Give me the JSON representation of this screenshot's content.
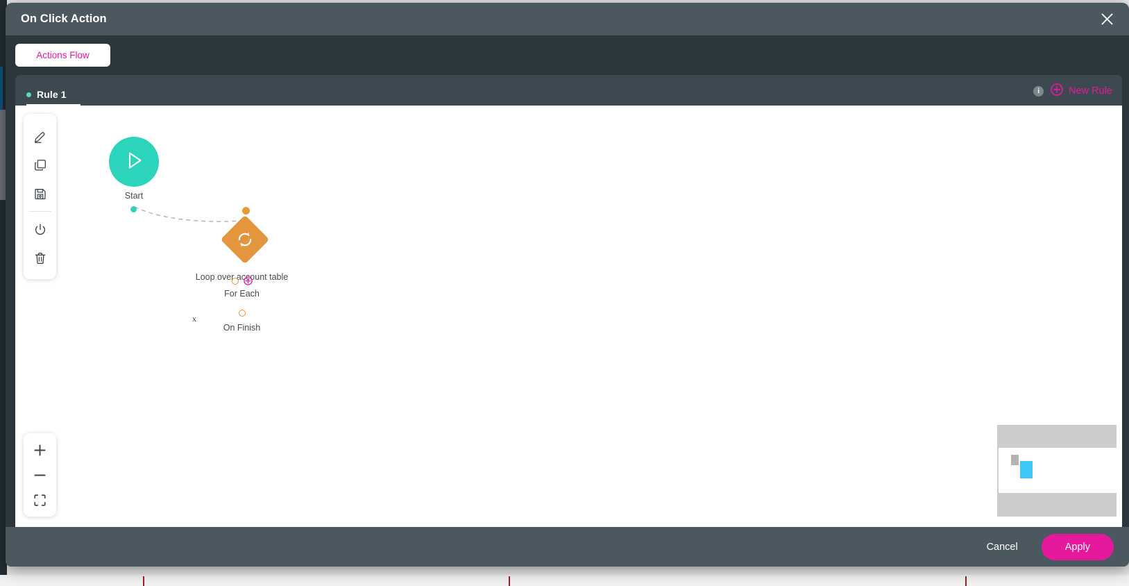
{
  "modal": {
    "title": "On Click Action",
    "close_icon": "close-icon"
  },
  "flow_tab": {
    "label": "Actions Flow"
  },
  "rule_bar": {
    "rules": [
      {
        "label": "Rule 1",
        "status_color": "#5fd9b4",
        "active": true
      }
    ],
    "info_icon_label": "i",
    "new_rule_label": "New Rule",
    "new_rule_icon": "plus-circle-icon",
    "accent_color": "#e6189c"
  },
  "toolbar": {
    "items": [
      {
        "name": "edit-tool",
        "icon": "pencil-icon"
      },
      {
        "name": "duplicate-tool",
        "icon": "copy-icon"
      },
      {
        "name": "save-tool",
        "icon": "save-icon"
      },
      {
        "name": "power-tool",
        "icon": "power-icon"
      },
      {
        "name": "delete-tool",
        "icon": "trash-icon"
      }
    ]
  },
  "zoom_controls": {
    "items": [
      {
        "name": "zoom-in-button",
        "icon": "plus-icon"
      },
      {
        "name": "zoom-out-button",
        "icon": "minus-icon"
      },
      {
        "name": "fit-to-screen-button",
        "icon": "fit-frame-icon"
      }
    ]
  },
  "flow": {
    "start_node": {
      "label": "Start",
      "icon": "play-icon",
      "color": "#2bd4bb"
    },
    "loop_node": {
      "label": "Loop over account table",
      "icon": "loop-refresh-icon",
      "color": "#e3963e",
      "ports": [
        {
          "label": "For Each",
          "has_add": true,
          "add_color": "#e6189c"
        },
        {
          "label": "On Finish",
          "has_add": false
        }
      ]
    },
    "edge": {
      "remove_marker": "x",
      "style": "dashed",
      "color": "#b3b3b3"
    }
  },
  "minimap": {
    "name": "minimap"
  },
  "footer": {
    "cancel_label": "Cancel",
    "apply_label": "Apply",
    "apply_color": "#e6189c"
  }
}
